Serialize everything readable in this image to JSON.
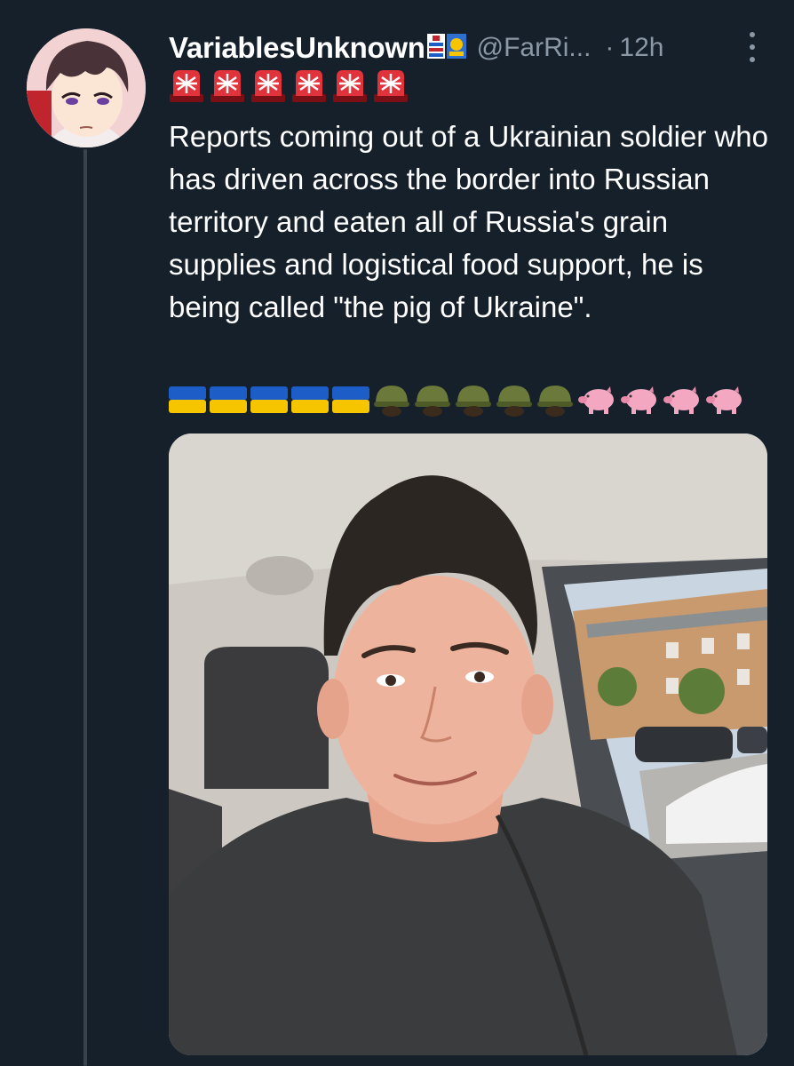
{
  "tweet": {
    "display_name": "VariablesUnknown",
    "handle": "@FarRi...",
    "separator": "·",
    "time": "12h",
    "text": "Reports coming out of a Ukrainian soldier who has driven across the border into Russian territory and eaten all of Russia's grain supplies and logistical food support, he is being called \"the pig of Ukraine\".",
    "emoji_lead": [
      "police-light-icon",
      "police-light-icon",
      "police-light-icon",
      "police-light-icon",
      "police-light-icon",
      "police-light-icon"
    ],
    "emoji_trail": {
      "flags": 5,
      "helmets": 5,
      "pigs": 4
    }
  },
  "colors": {
    "background": "#15202b",
    "secondary_text": "#8b98a5",
    "thread_line": "#38444d",
    "siren_red": "#e0333b",
    "flag_blue": "#1d5dc7",
    "flag_yellow": "#f7c500",
    "pig_pink": "#f4a7c0"
  }
}
